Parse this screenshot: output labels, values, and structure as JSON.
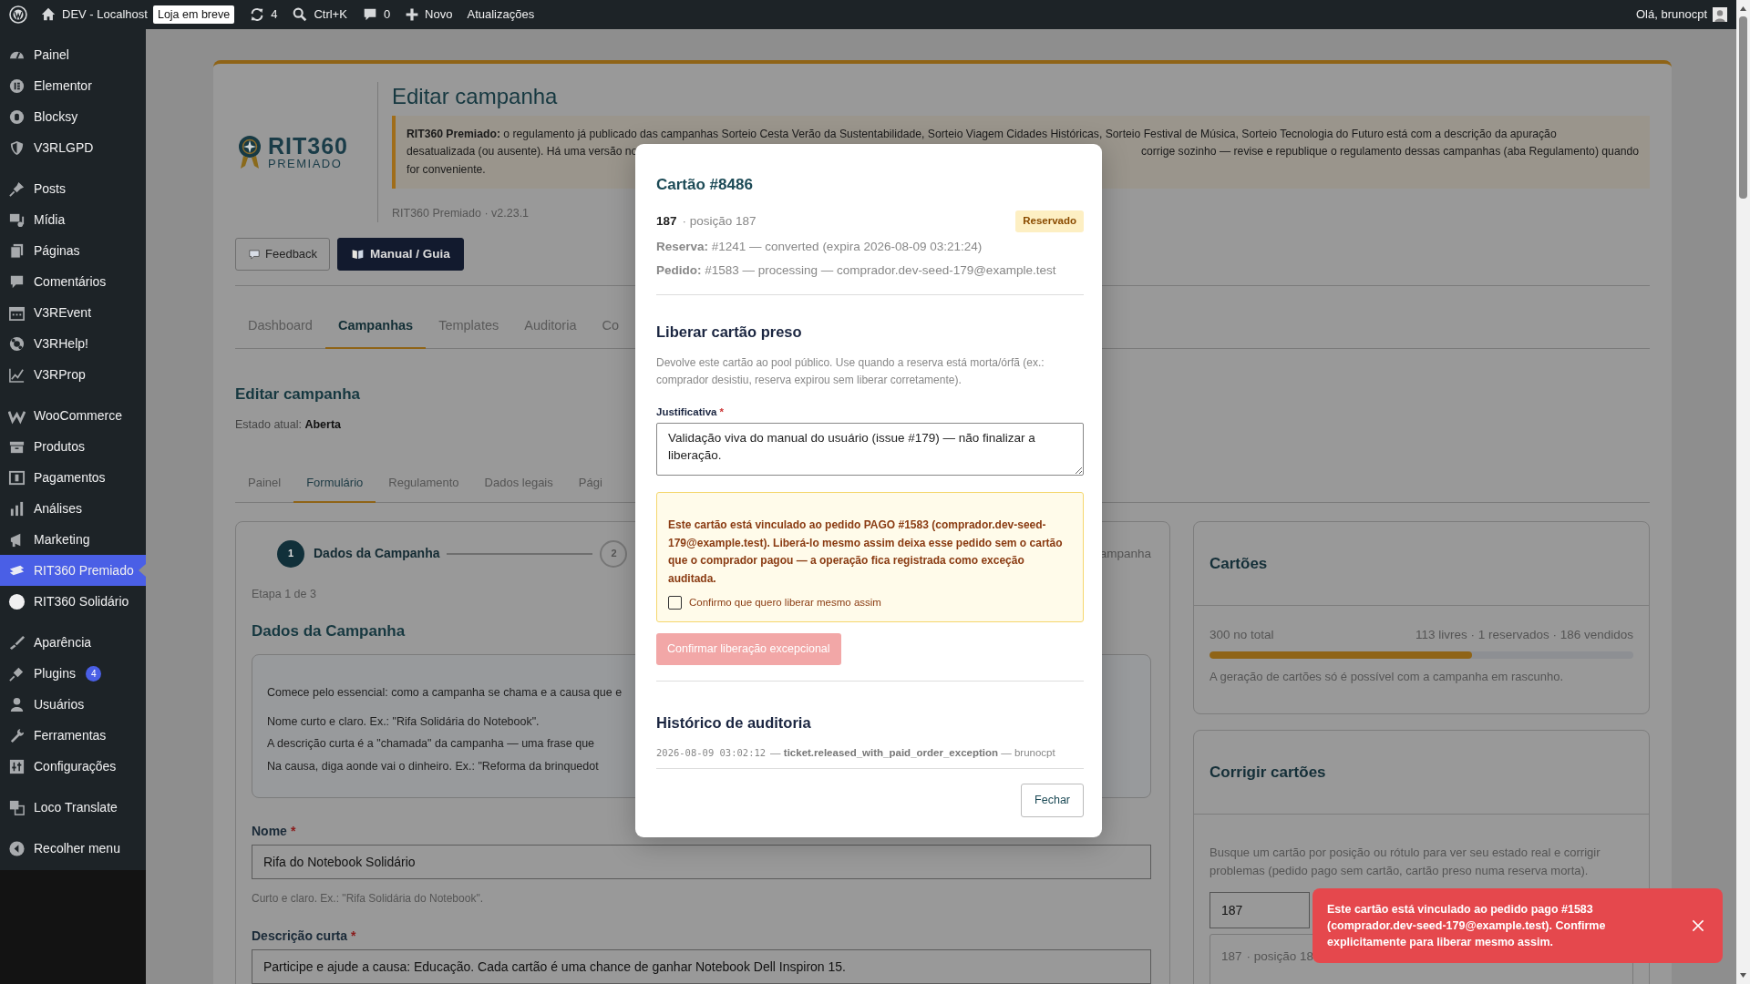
{
  "admin_bar": {
    "site": "DEV - Localhost",
    "store_badge": "Loja em breve",
    "updates_count": "4",
    "search_shortcut": "Ctrl+K",
    "comments_count": "0",
    "new_label": "Novo",
    "updates_label": "Atualizações",
    "greeting": "Olá, brunocpt"
  },
  "sidebar": {
    "groups": [
      [
        {
          "label": "Painel",
          "selected": false
        },
        {
          "label": "Elementor",
          "selected": false
        },
        {
          "label": "Blocksy",
          "selected": false
        },
        {
          "label": "V3RLGPD",
          "selected": false
        }
      ],
      [
        {
          "label": "Posts",
          "selected": false
        },
        {
          "label": "Mídia",
          "selected": false
        },
        {
          "label": "Páginas",
          "selected": false
        },
        {
          "label": "Comentários",
          "selected": false
        },
        {
          "label": "V3REvent",
          "selected": false
        },
        {
          "label": "V3RHelp!",
          "selected": false
        },
        {
          "label": "V3RProp",
          "selected": false
        }
      ],
      [
        {
          "label": "WooCommerce",
          "selected": false
        },
        {
          "label": "Produtos",
          "selected": false
        },
        {
          "label": "Pagamentos",
          "selected": false
        },
        {
          "label": "Análises",
          "selected": false
        },
        {
          "label": "Marketing",
          "selected": false
        },
        {
          "label": "RIT360 Premiado",
          "selected": true
        },
        {
          "label": "RIT360 Solidário",
          "selected": false
        }
      ],
      [
        {
          "label": "Aparência",
          "selected": false
        },
        {
          "label": "Plugins",
          "selected": false,
          "badge": "4"
        },
        {
          "label": "Usuários",
          "selected": false
        },
        {
          "label": "Ferramentas",
          "selected": false
        },
        {
          "label": "Configurações",
          "selected": false
        }
      ],
      [
        {
          "label": "Loco Translate",
          "selected": false
        }
      ],
      [
        {
          "label": "Recolher menu",
          "selected": false
        }
      ]
    ]
  },
  "header": {
    "logo_name": "RIT360",
    "logo_sub": "PREMIADO",
    "title": "Editar campanha",
    "notice_lines": [
      [
        "**RIT360 Premiado:** o regulamento já publicado das campanhas Sorteio Cesta Verão da Sustentabilidade, Sorteio Viagem Cidades Históricas, Sorteio Festival de Música, Sorteio Tecnologia do Futuro está com a descrição da apuração"
      ],
      [
        "desatualizada (ou ausente). Há uma versão no",
        "corrige sozinho — revise e republique o regulamento dessas campanhas (aba Regulamento) quando"
      ],
      [
        "for conveniente."
      ]
    ],
    "version": "RIT360 Premiado · v2.23.1"
  },
  "actions": [
    {
      "label": "Feedback",
      "kind": "outline"
    },
    {
      "label": "Manual / Guia",
      "kind": "dark"
    }
  ],
  "tabs": [
    {
      "label": "Dashboard",
      "selected": false
    },
    {
      "label": "Campanhas",
      "selected": true
    },
    {
      "label": "Templates",
      "selected": false
    },
    {
      "label": "Auditoria",
      "selected": false
    },
    {
      "label": "Co",
      "selected": false
    }
  ],
  "section": {
    "title": "Editar campanha",
    "status_label": "Estado atual:",
    "status_value": "Aberta"
  },
  "subtabs": [
    {
      "label": "Painel",
      "selected": false
    },
    {
      "label": "Formulário",
      "selected": true
    },
    {
      "label": "Regulamento",
      "selected": false
    },
    {
      "label": "Dados legais",
      "selected": false
    },
    {
      "label": "Pági",
      "selected": false
    }
  ],
  "form": {
    "steps": [
      {
        "number": "1",
        "label": "Dados da Campanha",
        "selected": true
      },
      {
        "number": "2",
        "selected": false
      },
      {
        "label": "ampanha",
        "selected": false
      }
    ],
    "step_counter": "Etapa 1 de 3",
    "title": "Dados da Campanha",
    "info_lines": [
      "Comece pelo essencial: como a campanha se chama e a causa que e",
      "Nome curto e claro. Ex.: \"Rifa Solidária do Notebook\".",
      "A descrição curta é a \"chamada\" da campanha — uma frase que",
      "Na causa, diga aonde vai o dinheiro. Ex.: \"Reforma da brinquedot"
    ],
    "fields": [
      {
        "label": "Nome",
        "required_mark": "*",
        "value": "Rifa do Notebook Solidário",
        "hint": "Curto e claro. Ex.: \"Rifa Solidária do Notebook\"."
      },
      {
        "label": "Descrição curta",
        "required_mark": "*",
        "value": "Participe e ajude a causa: Educação. Cada cartão é uma chance de ganhar Notebook Dell Inspiron 15."
      }
    ]
  },
  "cards_panel": {
    "title": "Cartões",
    "total": "300 no total",
    "breakdown": "113 livres · 1 reservados · 186 vendidos",
    "level": 0.62,
    "note": "A geração de cartões só é possível com a campanha em rascunho."
  },
  "fix_panel": {
    "title": "Corrigir cartões",
    "description": "Busque um cartão por posição ou rótulo para ver seu estado real e corrigir problemas (pedido pago sem cartão, cartão preso numa reserva morta).",
    "search_value": "187",
    "result_label": "187",
    "result_position": "· posição 18"
  },
  "modal": {
    "title": "Cartão #8486",
    "label": "187",
    "position": "· posição 187",
    "status": "Reservado",
    "reservation": "**Reserva:** #1241 — converted (expira 2026-08-09 03:21:24)",
    "order": "**Pedido:** #1583 — processing — comprador.dev-seed-179@example.test",
    "release_title": "Liberar cartão preso",
    "release_description": "Devolve este cartão ao pool público. Use quando a reserva está morta/órfã (ex.: comprador desistiu, reserva expirou sem liberar corretamente).",
    "justification_label": "Justificativa",
    "justification_mark": "*",
    "justification_value": "Validação viva do manual do usuário (issue #179) — não finalizar a liberação.",
    "warning": "Este cartão está vinculado ao pedido PAGO #1583 (comprador.dev-seed-179@example.test). Liberá-lo mesmo assim deixa esse pedido sem o cartão que o comprador pagou — a operação fica registrada como exceção auditada.",
    "confirm_checkbox": {
      "label": "Confirmo que quero liberar mesmo assim",
      "checked": false
    },
    "confirm_button": {
      "label": "Confirmar liberação excepcional",
      "disabled": true
    },
    "audit_title": "Histórico de auditoria",
    "audit": [
      {
        "time": "2026-08-09 03:02:12",
        "detail": "— **ticket.released_with_paid_order_exception** — brunocpt"
      }
    ],
    "close_label": "Fechar"
  },
  "toast": {
    "message": "Este cartão está vinculado ao pedido pago #1583 (comprador.dev-seed-179@example.test). Confirme explicitamente para liberar mesmo assim."
  }
}
